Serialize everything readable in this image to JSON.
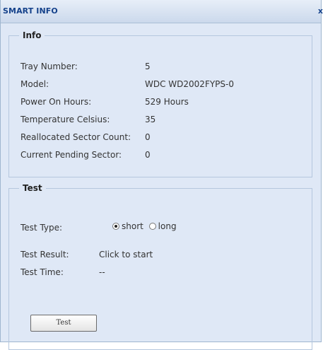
{
  "window": {
    "title": "SMART INFO",
    "close_glyph": "x"
  },
  "info": {
    "legend": "Info",
    "rows": [
      {
        "label": "Tray Number:",
        "value": "5"
      },
      {
        "label": "Model:",
        "value": "WDC WD2002FYPS-0"
      },
      {
        "label": "Power On Hours:",
        "value": "529 Hours"
      },
      {
        "label": "Temperature Celsius:",
        "value": "35"
      },
      {
        "label": "Reallocated Sector Count:",
        "value": "0"
      },
      {
        "label": "Current Pending Sector:",
        "value": "0"
      }
    ]
  },
  "test": {
    "legend": "Test",
    "type_label": "Test Type:",
    "options": [
      {
        "label": "short",
        "checked": true
      },
      {
        "label": "long",
        "checked": false
      }
    ],
    "result_label": "Test Result:",
    "result_value": "Click to start",
    "time_label": "Test Time:",
    "time_value": "--",
    "button_label": "Test"
  }
}
